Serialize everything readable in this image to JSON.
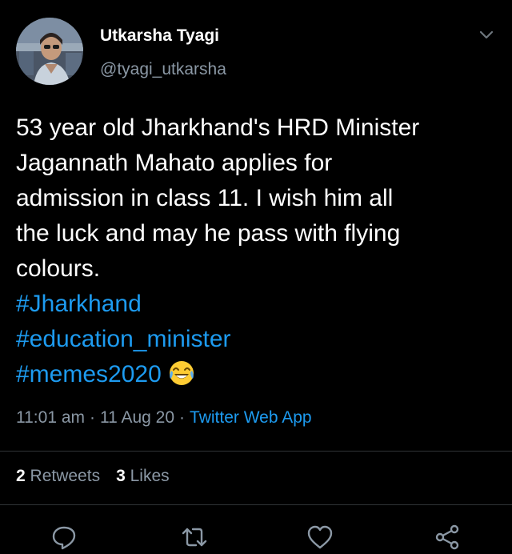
{
  "user": {
    "display_name": "Utkarsha Tyagi",
    "handle": "@tyagi_utkarsha",
    "avatar_icon": "avatar-photo"
  },
  "tweet": {
    "lines": [
      "53 year old Jharkhand's HRD Minister",
      "Jagannath Mahato applies for",
      "admission in class 11. I wish him all",
      "the luck and may he pass with flying",
      "colours."
    ],
    "hashtags": [
      "#Jharkhand",
      "#education_minister",
      "#memes2020"
    ],
    "emoji": "face-with-tears-of-joy"
  },
  "meta": {
    "time": "11:01 am",
    "separator": "·",
    "date": "11 Aug 20",
    "source": "Twitter Web App"
  },
  "stats": {
    "retweets_count": "2",
    "retweets_label": "Retweets",
    "likes_count": "3",
    "likes_label": "Likes"
  },
  "actions": [
    "reply-icon",
    "retweet-icon",
    "like-icon",
    "share-icon"
  ],
  "colors": {
    "background": "#000000",
    "text": "#ffffff",
    "secondary": "#8b98a5",
    "link": "#1d9bf0",
    "divider": "#2f3336"
  }
}
